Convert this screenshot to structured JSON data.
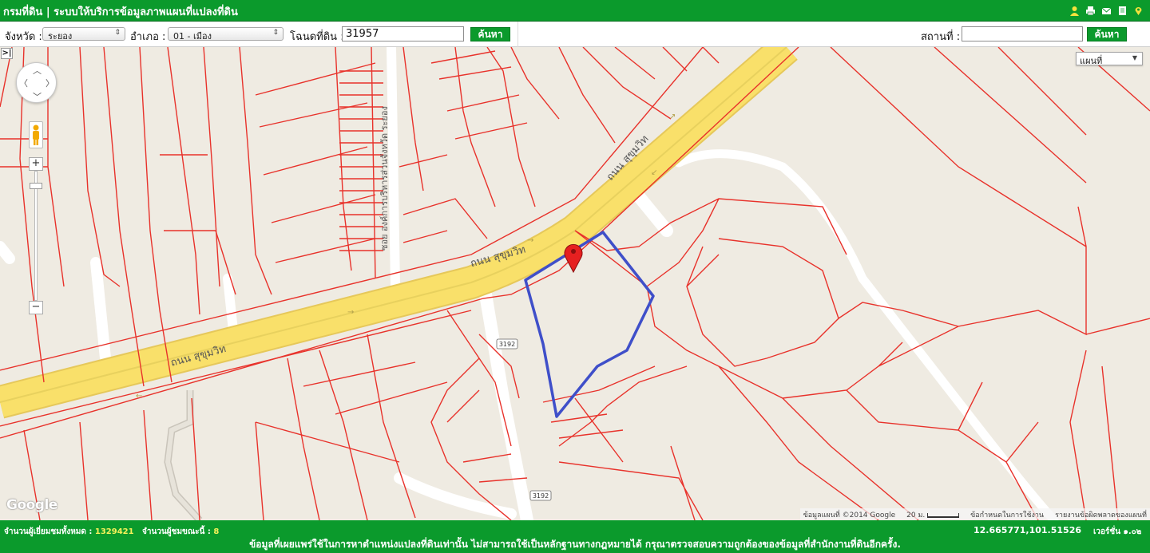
{
  "header": {
    "title": "กรมที่ดิน | ระบบให้บริการข้อมูลภาพแผนที่แปลงที่ดิน",
    "icons": [
      "user-icon",
      "print-icon",
      "mail-icon",
      "document-icon",
      "location-icon"
    ]
  },
  "search": {
    "province_label": "จังหวัด :",
    "province_value": "ระยอง",
    "district_label": "อำเภอ :",
    "district_value": "01 - เมือง",
    "deed_label": "โฉนดที่ดิน :",
    "deed_value": "31957",
    "search_button": "ค้นหา",
    "place_label": "สถานที่ :",
    "place_value": "",
    "place_button": "ค้นหา"
  },
  "map": {
    "toggle_label": ">|",
    "map_type": "แผนที่",
    "road_labels": [
      "ถนน สุขุมวิท",
      "ถนน สุขุมวิท",
      "ถนน สุขุมวิท",
      "ซอย องค์การบริหารส่วนจังหวัด ระยอง"
    ],
    "route_shield": "3192",
    "google_logo": "Google",
    "attribution": "ข้อมูลแผนที่ ©2014 Google",
    "scale": "20 ม.",
    "terms": "ข้อกำหนดในการใช้งาน",
    "report": "รายงานข้อผิดพลาดของแผนที่"
  },
  "footer": {
    "total_visitors_label": "จำนวนผู้เยี่ยมชมทั้งหมด :",
    "total_visitors": "1329421",
    "current_visitors_label": "จำนวนผู้ชมขณะนี้ :",
    "current_visitors": "8",
    "coordinates": "12.665771,101.51526",
    "version": "เวอร์ชั่น ๑.๐๒",
    "notice": "ข้อมูลที่เผยแพร่ใช้ในการหาตำแหน่งแปลงที่ดินเท่านั้น ไม่สามารถใช้เป็นหลักฐานทางกฎหมายได้ กรุณาตรวจสอบความถูกต้องของข้อมูลที่สำนักงานที่ดินอีกครั้ง."
  },
  "colors": {
    "header_green": "#0b9a2c",
    "parcel_line": "#e8322b",
    "parcel_highlight": "#3f4fc9",
    "road_yellow": "#f9e06a",
    "marker_red": "#e62020"
  }
}
